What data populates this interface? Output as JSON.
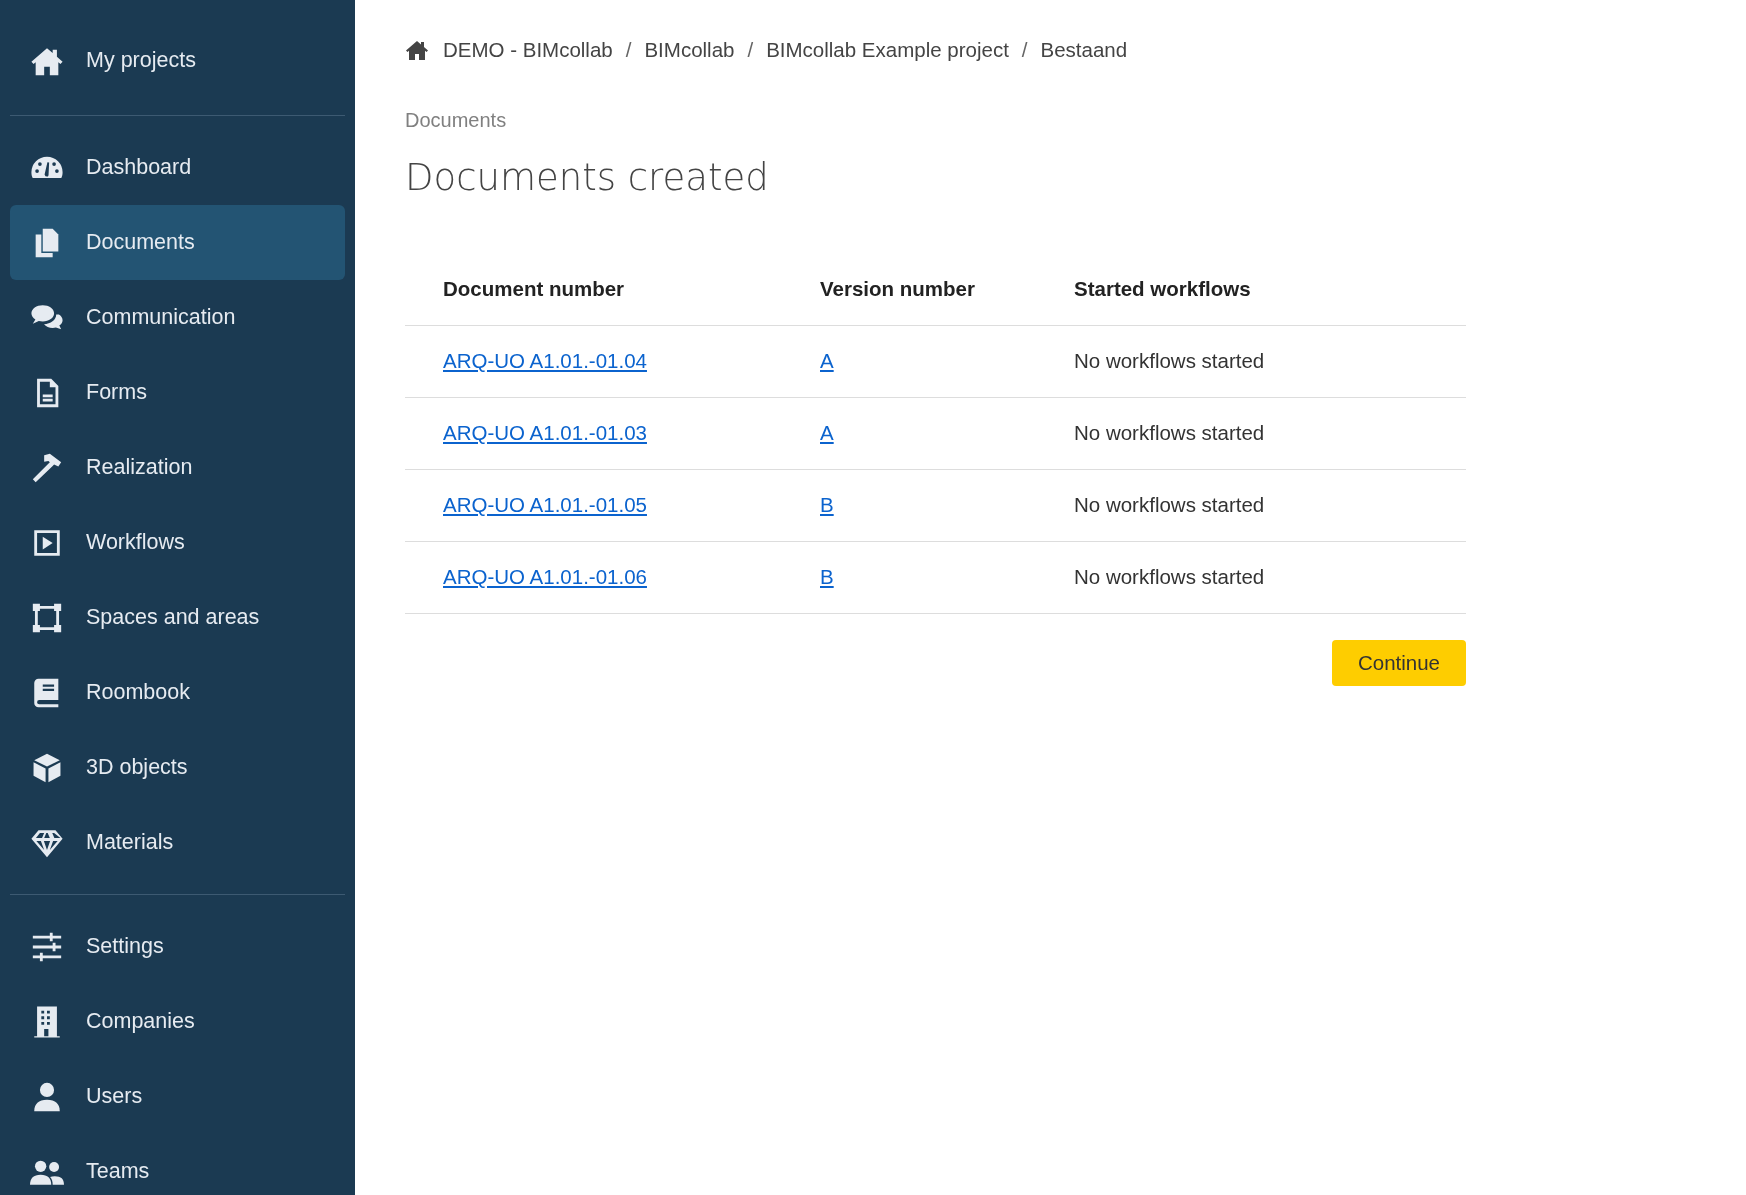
{
  "sidebar": {
    "groups": [
      {
        "items": [
          {
            "label": "My projects",
            "selected": false
          }
        ]
      },
      {
        "items": [
          {
            "label": "Dashboard",
            "selected": false
          },
          {
            "label": "Documents",
            "selected": true
          },
          {
            "label": "Communication",
            "selected": false
          },
          {
            "label": "Forms",
            "selected": false
          },
          {
            "label": "Realization",
            "selected": false
          },
          {
            "label": "Workflows",
            "selected": false
          },
          {
            "label": "Spaces and areas",
            "selected": false
          },
          {
            "label": "Roombook",
            "selected": false
          },
          {
            "label": "3D objects",
            "selected": false
          },
          {
            "label": "Materials",
            "selected": false
          }
        ]
      },
      {
        "items": [
          {
            "label": "Settings",
            "selected": false
          },
          {
            "label": "Companies",
            "selected": false
          },
          {
            "label": "Users",
            "selected": false
          },
          {
            "label": "Teams",
            "selected": false
          }
        ]
      }
    ]
  },
  "breadcrumb": {
    "items": [
      "DEMO - BIMcollab",
      "BIMcollab",
      "BIMcollab Example project",
      "Bestaand"
    ],
    "separators": [
      "/",
      "/",
      "/"
    ]
  },
  "section_label": "Documents",
  "title": "Documents created",
  "table": {
    "columns": [
      "Document number",
      "Version number",
      "Started workflows"
    ],
    "rows": [
      {
        "document": "ARQ-UO A1.01.-01.04",
        "version": "A",
        "workflows": "No workflows started"
      },
      {
        "document": "ARQ-UO A1.01.-01.03",
        "version": "A",
        "workflows": "No workflows started"
      },
      {
        "document": "ARQ-UO A1.01.-01.05",
        "version": "B",
        "workflows": "No workflows started"
      },
      {
        "document": "ARQ-UO A1.01.-01.06",
        "version": "B",
        "workflows": "No workflows started"
      }
    ]
  },
  "continue_button": "Continue"
}
